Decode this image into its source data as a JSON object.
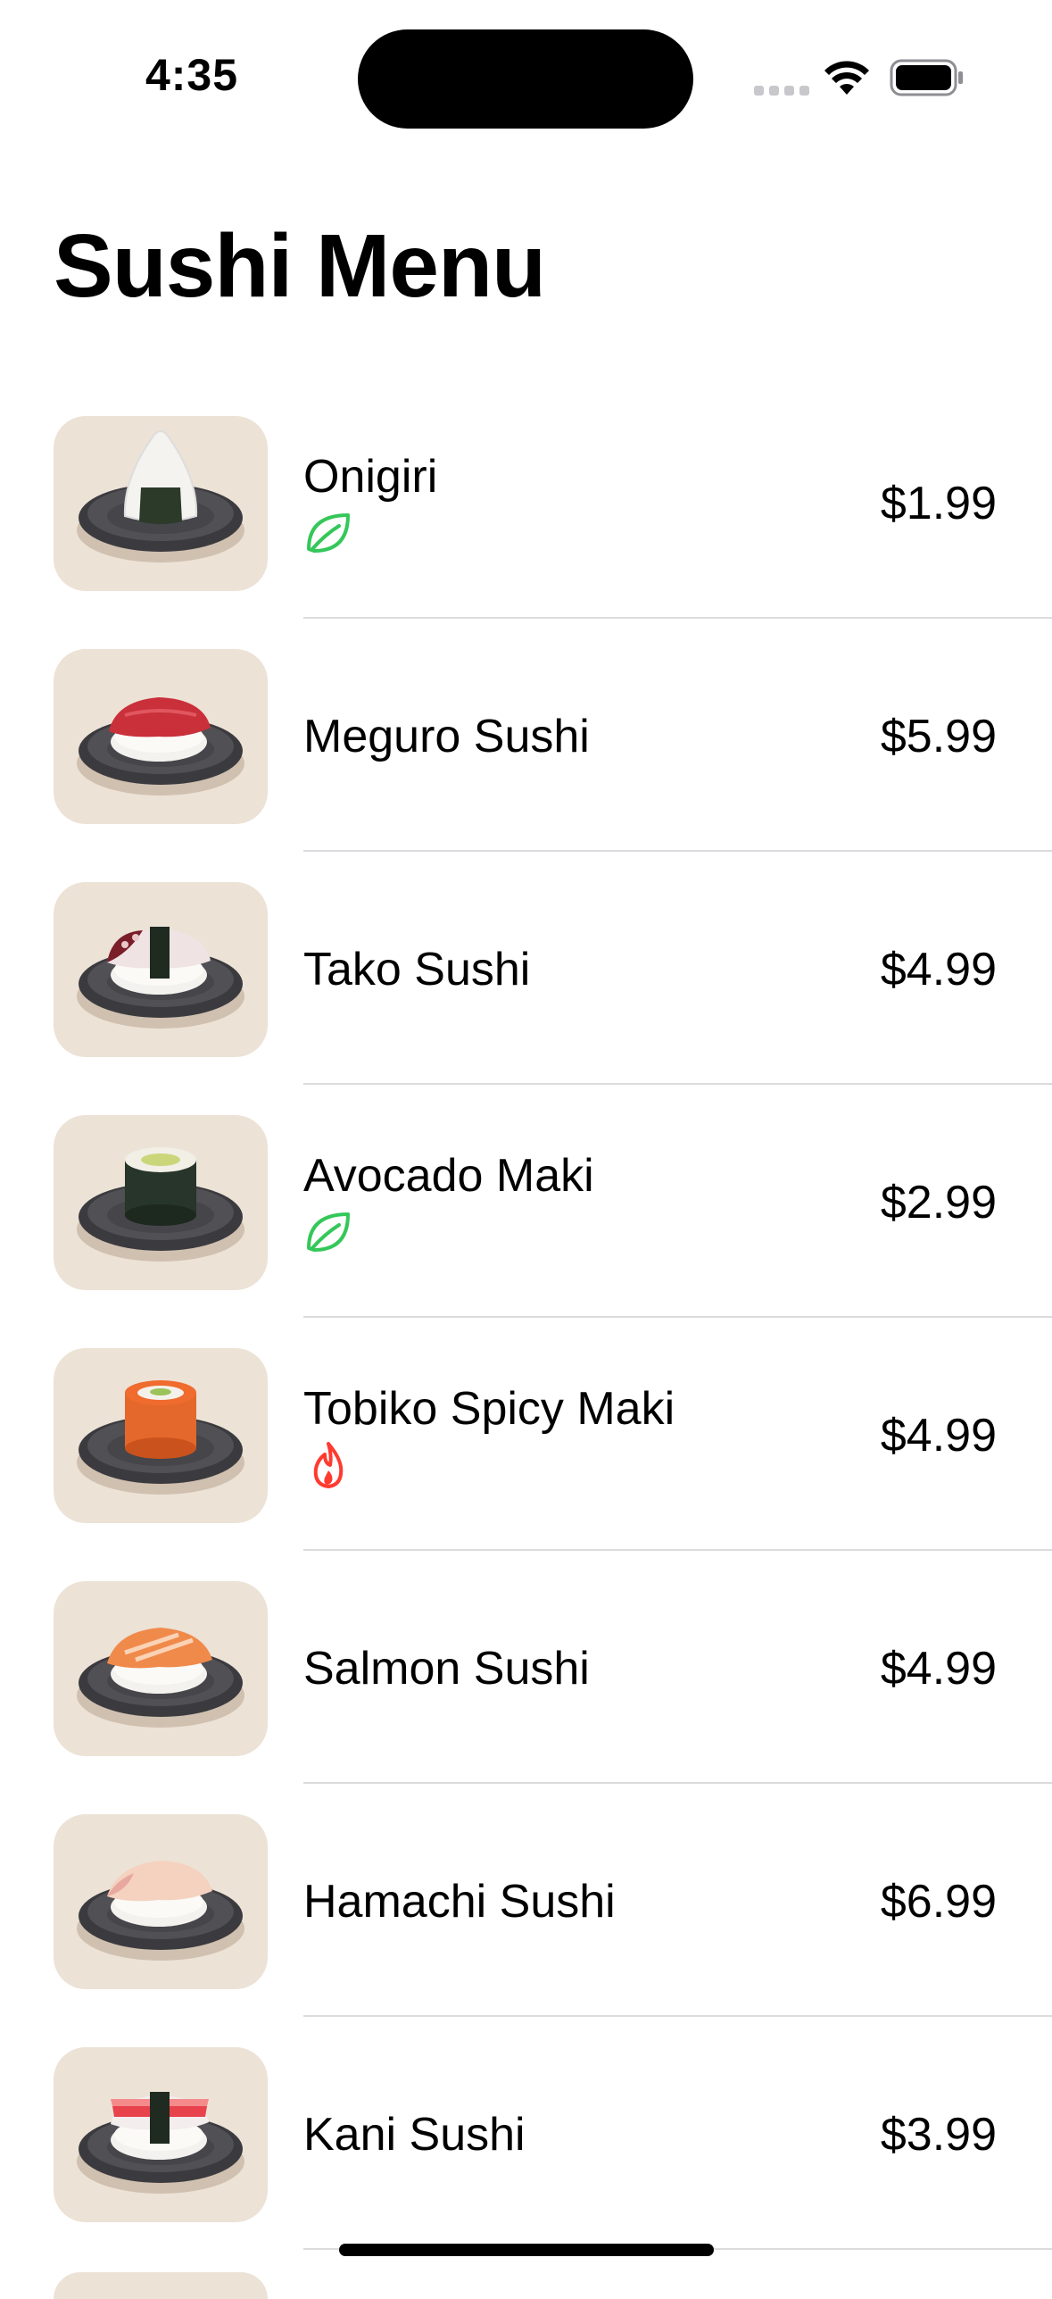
{
  "status_bar": {
    "time": "4:35"
  },
  "header": {
    "title": "Sushi Menu"
  },
  "colors": {
    "vegetarian": "#34c759",
    "spicy": "#ff3b30",
    "thumb_bg": "#ece2d6",
    "plate": "#3f3f43"
  },
  "menu": {
    "items": [
      {
        "name": "Onigiri",
        "price": "$1.99",
        "tag": "leaf-icon",
        "dish": "onigiri"
      },
      {
        "name": "Meguro Sushi",
        "price": "$5.99",
        "tag": null,
        "dish": "tuna-nigiri"
      },
      {
        "name": "Tako Sushi",
        "price": "$4.99",
        "tag": null,
        "dish": "octopus-nigiri"
      },
      {
        "name": "Avocado Maki",
        "price": "$2.99",
        "tag": "leaf-icon",
        "dish": "avocado-maki"
      },
      {
        "name": "Tobiko Spicy Maki",
        "price": "$4.99",
        "tag": "flame-icon",
        "dish": "tobiko-maki"
      },
      {
        "name": "Salmon Sushi",
        "price": "$4.99",
        "tag": null,
        "dish": "salmon-nigiri"
      },
      {
        "name": "Hamachi Sushi",
        "price": "$6.99",
        "tag": null,
        "dish": "hamachi-nigiri"
      },
      {
        "name": "Kani Sushi",
        "price": "$3.99",
        "tag": null,
        "dish": "crab-nigiri"
      }
    ]
  }
}
